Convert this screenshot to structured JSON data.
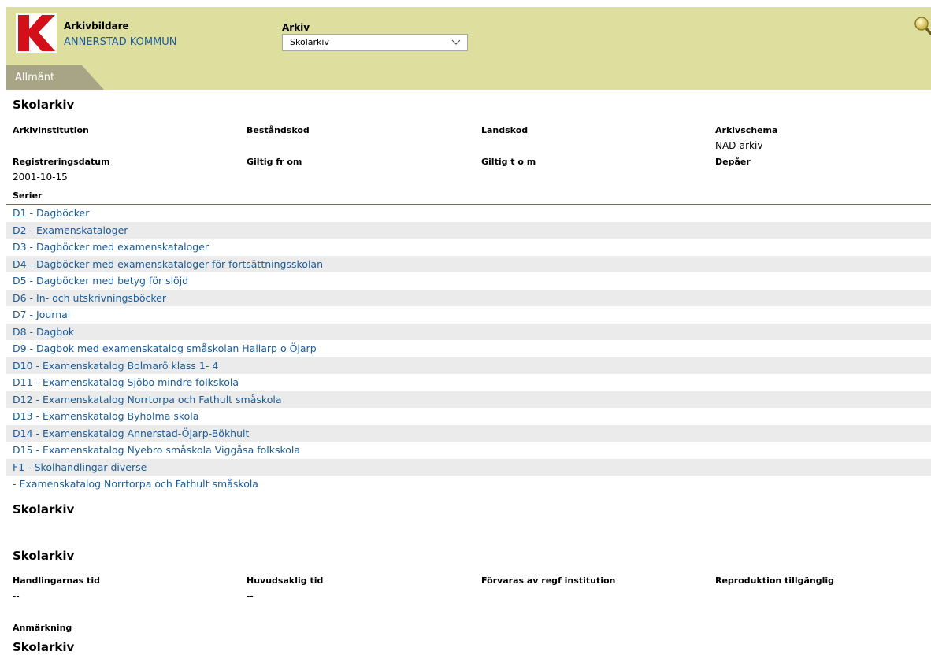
{
  "header": {
    "creator_label": "Arkivbildare",
    "creator_value": "ANNERSTAD KOMMUN",
    "archive_label": "Arkiv",
    "archive_selected": "Skolarkiv",
    "tab_label": "Allmänt",
    "icons": {
      "logo": "k-logo",
      "search": "search-icon",
      "dropdown": "chevron-down-icon"
    },
    "colors": {
      "header_bg": "#dede9e",
      "tab_bg": "#a7a586",
      "logo_red": "#d3101a",
      "link": "#1a5c9a"
    }
  },
  "section1": {
    "title": "Skolarkiv",
    "fields": {
      "arkivinstitution_label": "Arkivinstitution",
      "bestandskod_label": "Beståndskod",
      "landskod_label": "Landskod",
      "arkivschema_label": "Arkivschema",
      "arkivschema_value": "NAD-arkiv",
      "registreringsdatum_label": "Registreringsdatum",
      "registreringsdatum_value": "2001-10-15",
      "giltig_from_label": "Giltig fr om",
      "giltig_tom_label": "Giltig t o m",
      "depaer_label": "Depåer"
    },
    "serier_label": "Serier",
    "series": [
      "D1 - Dagböcker",
      "D2 - Examenskataloger",
      "D3 - Dagböcker med examenskataloger",
      "D4 - Dagböcker med examenskataloger för fortsättningsskolan",
      "D5 - Dagböcker med betyg för slöjd",
      "D6 - In- och utskrivningsböcker",
      "D7 - Journal",
      "D8 - Dagbok",
      "D9 - Dagbok med examenskatalog småskolan Hallarp o Öjarp",
      "D10 - Examenskatalog Bolmarö klass 1- 4",
      "D11 - Examenskatalog Sjöbo mindre folkskola",
      "D12 - Examenskatalog Norrtorpa och Fathult småskola",
      "D13 - Examenskatalog Byholma skola",
      "D14 - Examenskatalog Annerstad-Öjarp-Bökhult",
      "D15 - Examenskatalog Nyebro småskola Viggåsa folkskola",
      "F1 - Skolhandlingar diverse",
      " - Examenskatalog Norrtorpa och Fathult småskola"
    ]
  },
  "section2": {
    "title": "Skolarkiv"
  },
  "section3": {
    "title": "Skolarkiv",
    "handlingarnas_tid_label": "Handlingarnas tid",
    "handlingarnas_tid_value": "--",
    "huvudsaklig_tid_label": "Huvudsaklig tid",
    "huvudsaklig_tid_value": "--",
    "forvaras_label": "Förvaras av regf institution",
    "reproduktion_label": "Reproduktion tillgänglig",
    "anmarkning_label": "Anmärkning"
  },
  "section4": {
    "title": "Skolarkiv"
  }
}
